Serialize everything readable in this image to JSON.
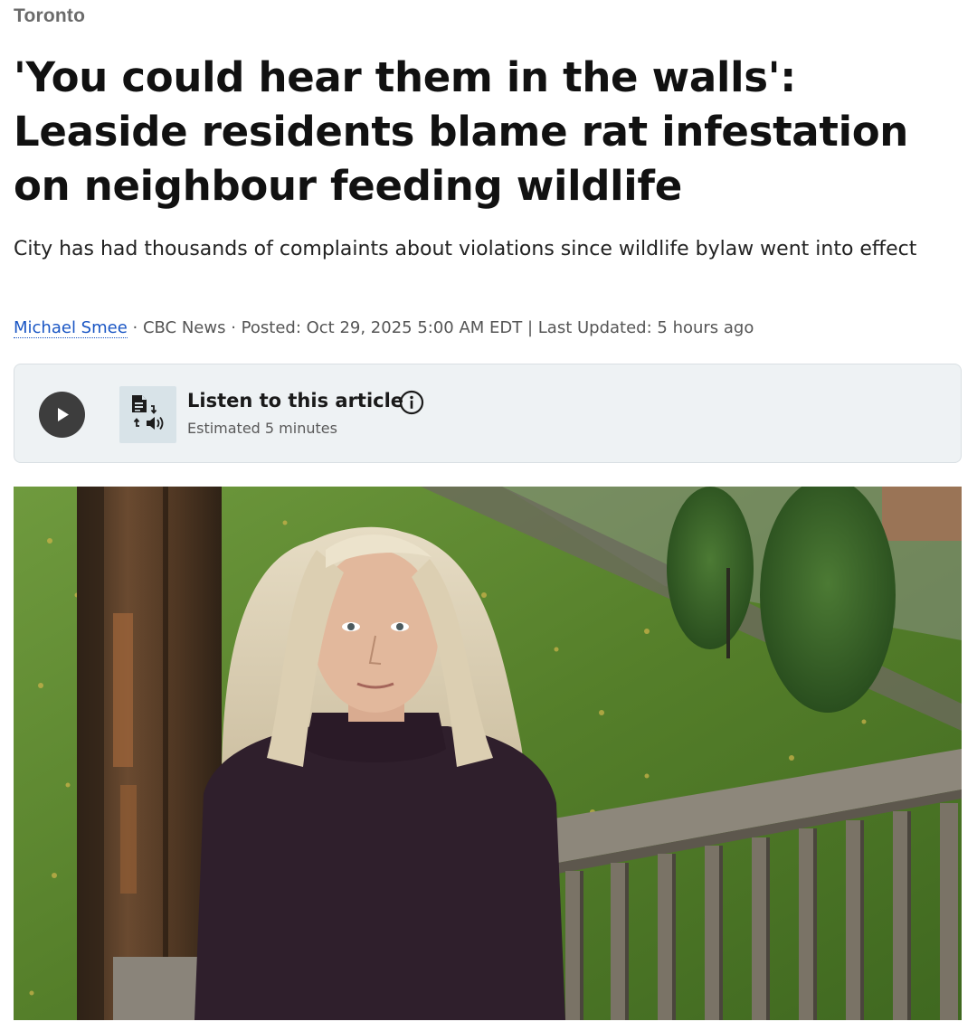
{
  "section": {
    "label": "Toronto"
  },
  "article": {
    "headline": "'You could hear them in the walls': Leaside residents blame rat infestation on neighbour feeding wildlife",
    "deck": "City has had thousands of complaints about violations since wildlife bylaw went into effect",
    "byline": {
      "author": "Michael Smee",
      "separator_1": " · ",
      "outlet": "CBC News",
      "separator_2": " · ",
      "posted": "Posted: Oct 29, 2025 5:00 AM EDT",
      "separator_3": " | ",
      "updated": "Last Updated: 5 hours ago"
    }
  },
  "audio_player": {
    "title": "Listen to this article",
    "duration": "Estimated 5 minutes",
    "play_icon": "play-icon",
    "tts_icon": "text-to-speech-icon",
    "info_icon": "info-icon"
  },
  "photo": {
    "subject": "woman-on-porch-photo"
  },
  "colors": {
    "section": "#6b6b6b",
    "author_link": "#1a56c4",
    "player_bg": "#eef2f4",
    "play_button": "#3d3d3d",
    "tts_tile": "#d8e3e8"
  }
}
